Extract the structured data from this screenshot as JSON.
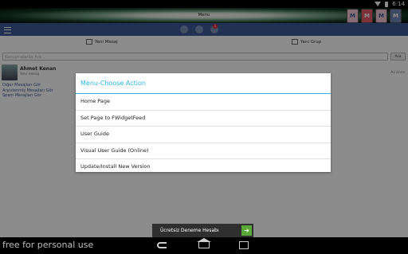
{
  "status_bar": {
    "time": "6:14"
  },
  "app_bar": {
    "title": "Menu",
    "app_icons": [
      "M",
      "M",
      "M",
      "M"
    ]
  },
  "nav": {
    "badge_count": "1"
  },
  "actions": {
    "new_message": "Yeni Mesaj",
    "new_group": "Yeni Grup"
  },
  "search": {
    "placeholder": "Konuşmalarda Ara...",
    "button": "Ara"
  },
  "message": {
    "name": "Ahmet Kenan",
    "text": "Yeni mesaj",
    "date": "Az önce"
  },
  "links": [
    "Diğer Mesajları Gör",
    "Arşivlenmiş Mesajları Gör",
    "Spam Mesajları Gör"
  ],
  "dialog": {
    "title": "Menu-Choose Action",
    "items": [
      "Home Page",
      "Set Page to FWidgetFeed",
      "User Guide",
      "Visual User Guide (Online)",
      "Update/Install New Version"
    ]
  },
  "ad": {
    "text": "Ücretsiz Deneme Hesabı",
    "arrow": "➜"
  },
  "watermark": "free for personal use",
  "colors": {
    "fb_blue": "#3c5a98",
    "holo_blue": "#33b5e5",
    "ad_green": "#5aa83a"
  }
}
